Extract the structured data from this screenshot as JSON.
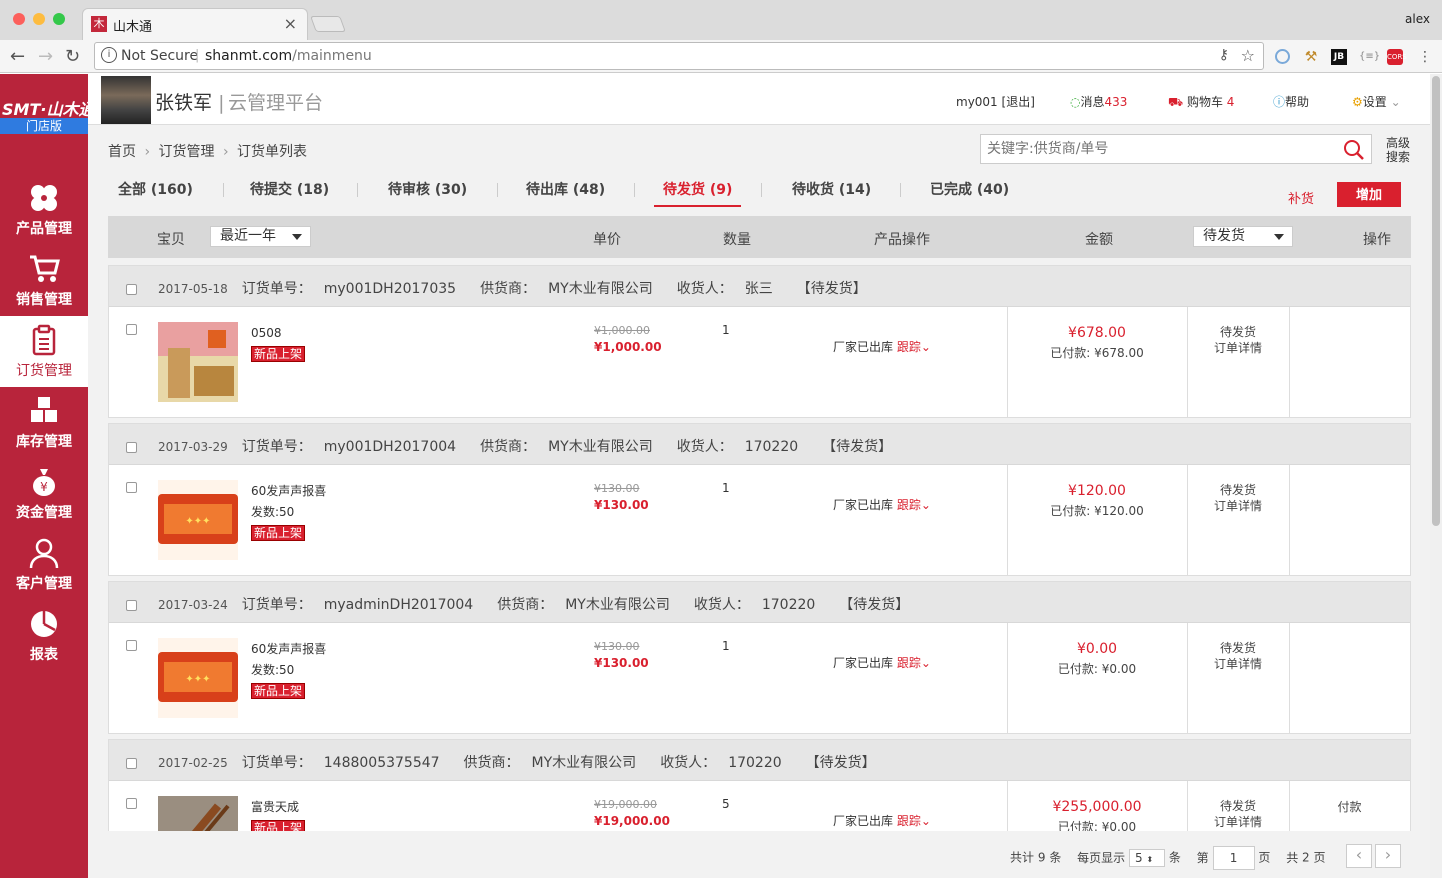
{
  "browser": {
    "tab_title": "山木通",
    "tab_favicon": "木",
    "profile": "alex",
    "security": "Not Secure",
    "url_domain": "shanmt.com",
    "url_path": "/mainmenu"
  },
  "sidebar": {
    "logo": "SMT·山木通",
    "edition": "门店版",
    "items": [
      {
        "label": "产品管理",
        "icon": "flower-icon"
      },
      {
        "label": "销售管理",
        "icon": "cart-icon"
      },
      {
        "label": "订货管理",
        "icon": "clipboard-icon",
        "active": true
      },
      {
        "label": "库存管理",
        "icon": "boxes-icon"
      },
      {
        "label": "资金管理",
        "icon": "money-bag-icon"
      },
      {
        "label": "客户管理",
        "icon": "user-icon"
      },
      {
        "label": "报表",
        "icon": "pie-chart-icon"
      }
    ]
  },
  "header": {
    "store_name": "张铁军",
    "separator": "|",
    "platform": "云管理平台",
    "user": "my001",
    "logout": "[退出]",
    "messages_label": "消息",
    "messages_count": "433",
    "cart_label": "购物车",
    "cart_count": "4",
    "help": "帮助",
    "settings": "设置"
  },
  "breadcrumb": {
    "home": "首页",
    "section": "订货管理",
    "page": "订货单列表"
  },
  "search": {
    "placeholder": "关键字:供货商/单号",
    "advanced_1": "高级",
    "advanced_2": "搜索"
  },
  "tabs": [
    "全部 (160)",
    "待提交 (18)",
    "待审核 (30)",
    "待出库 (48)",
    "待发货 (9)",
    "待收货 (14)",
    "已完成 (40)"
  ],
  "actions": {
    "restock": "补货",
    "add": "增加"
  },
  "table_header": {
    "item": "宝贝",
    "period": "最近一年",
    "unit_price": "单价",
    "quantity": "数量",
    "product_ops": "产品操作",
    "amount": "金额",
    "status_filter": "待发货",
    "operations": "操作"
  },
  "labels": {
    "order_no": "订货单号：",
    "supplier": "供货商：",
    "receiver": "收货人：",
    "paid": "已付款: ",
    "track": "跟踪",
    "factory_out": "厂家已出库",
    "detail": "订单详情",
    "new_badge": "新品上架"
  },
  "orders": [
    {
      "date": "2017-05-18",
      "order_no": "my001DH2017035",
      "supplier": "MY木业有限公司",
      "receiver": "张三",
      "status": "【待发货】",
      "product": "0508",
      "product_sub": "",
      "old_price": "¥1,000.00",
      "price": "¥1,000.00",
      "qty": "1",
      "amount": "¥678.00",
      "paid": "¥678.00",
      "state": "待发货",
      "op": ""
    },
    {
      "date": "2017-03-29",
      "order_no": "my001DH2017004",
      "supplier": "MY木业有限公司",
      "receiver": "170220",
      "status": "【待发货】",
      "product": "60发声声报喜",
      "product_sub": "发数:50",
      "old_price": "¥130.00",
      "price": "¥130.00",
      "qty": "1",
      "amount": "¥120.00",
      "paid": "¥120.00",
      "state": "待发货",
      "op": ""
    },
    {
      "date": "2017-03-24",
      "order_no": "myadminDH2017004",
      "supplier": "MY木业有限公司",
      "receiver": "170220",
      "status": "【待发货】",
      "product": "60发声声报喜",
      "product_sub": "发数:50",
      "old_price": "¥130.00",
      "price": "¥130.00",
      "qty": "1",
      "amount": "¥0.00",
      "paid": "¥0.00",
      "state": "待发货",
      "op": ""
    },
    {
      "date": "2017-02-25",
      "order_no": "1488005375547",
      "supplier": "MY木业有限公司",
      "receiver": "170220",
      "status": "【待发货】",
      "product": "富贵天成",
      "product_sub": "",
      "old_price": "¥19,000.00",
      "price": "¥19,000.00",
      "qty": "5",
      "amount": "¥255,000.00",
      "paid": "¥0.00",
      "state": "待发货",
      "op": "付款"
    }
  ],
  "pager": {
    "total_prefix": "共计",
    "total": "9",
    "total_suffix": "条",
    "per_page_label": "每页显示",
    "per_page": "5",
    "per_page_suffix": "条",
    "page_prefix": "第",
    "page": "1",
    "page_suffix": "页",
    "pages_label": "共",
    "pages": "2",
    "pages_suffix": "页"
  }
}
